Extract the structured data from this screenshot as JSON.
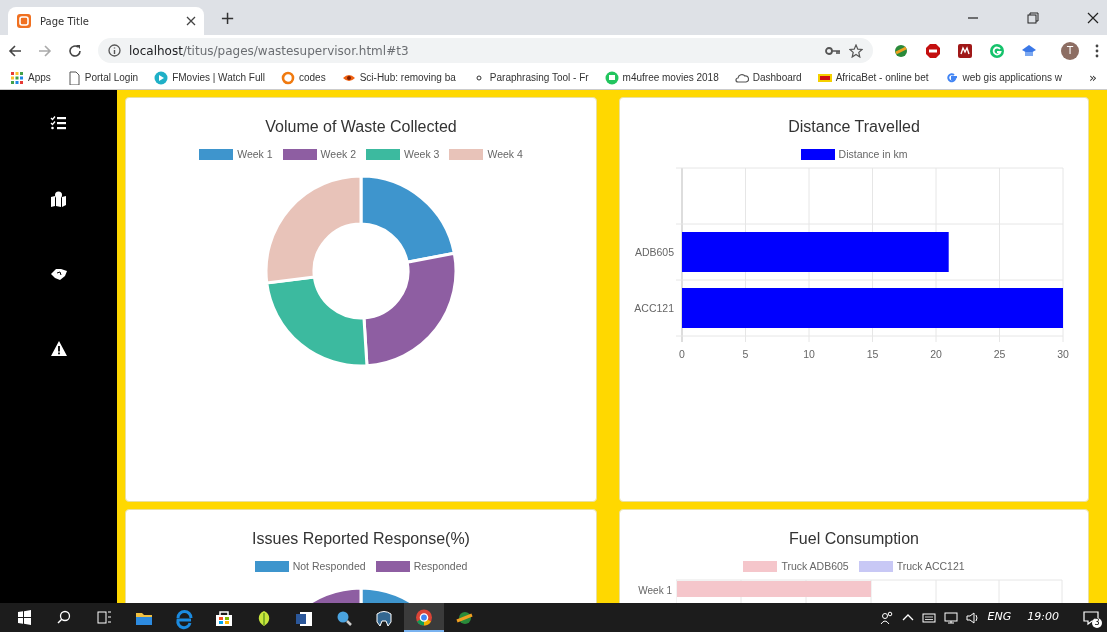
{
  "browser": {
    "tab": {
      "title": "Page Title",
      "selected": true
    },
    "address": {
      "host": "localhost",
      "path": "/titus/pages/wastesupervisor.html#t3"
    },
    "bookmarks": [
      {
        "label": "Apps"
      },
      {
        "label": "Portal Login"
      },
      {
        "label": "FMovies | Watch Full"
      },
      {
        "label": "codes"
      },
      {
        "label": "Sci-Hub: removing ba"
      },
      {
        "label": "Paraphrasing Tool - Fr"
      },
      {
        "label": "m4ufree movies 2018"
      },
      {
        "label": "Dashboard"
      },
      {
        "label": "AfricaBet - online bet"
      },
      {
        "label": "web gis applications w"
      }
    ],
    "more": "»",
    "profile": "T",
    "new_tab": "+"
  },
  "cards": [
    {
      "title": "Volume of Waste Collected",
      "kind": "donut",
      "legend": [
        {
          "label": "Week 1",
          "color": "#3e95cd"
        },
        {
          "label": "Week 2",
          "color": "#8e5ea2"
        },
        {
          "label": "Week 3",
          "color": "#3cba9f"
        },
        {
          "label": "Week 4",
          "color": "#e8c3b9"
        }
      ]
    },
    {
      "title": "Distance Travelled",
      "kind": "bar",
      "chart_data": {
        "type": "bar",
        "orientation": "horizontal",
        "categories": [
          "ADB605",
          "ACC121"
        ],
        "series": [
          {
            "name": "Distance in km",
            "color": "#0000ff",
            "values": [
              21,
              30
            ]
          }
        ],
        "grid": true,
        "xlim": [
          0,
          30
        ],
        "xticks": [
          0,
          5,
          10,
          15,
          20,
          25,
          30
        ]
      }
    },
    {
      "title": "Issues Reported Response(%)",
      "kind": "donut",
      "legend": [
        {
          "label": "Not Responded",
          "color": "#3e95cd"
        },
        {
          "label": "Responded",
          "color": "#8e5ea2"
        }
      ]
    },
    {
      "title": "Fuel Consumption",
      "kind": "partial-bar",
      "legend": [
        {
          "label": "Truck ADB605",
          "color": "#f5c6cb"
        },
        {
          "label": "Truck ACC121",
          "color": "#c8c8f5"
        }
      ],
      "category_label": "Week 1"
    }
  ],
  "taskbar": {
    "apps": [
      {
        "selected": false
      },
      {
        "selected": false
      },
      {
        "selected": false
      },
      {
        "selected": false
      },
      {
        "selected": false
      },
      {
        "selected": false
      },
      {
        "selected": false
      },
      {
        "selected": true
      },
      {
        "selected": false
      }
    ],
    "language": "ENG",
    "time": "19:00",
    "notifications": "3"
  }
}
